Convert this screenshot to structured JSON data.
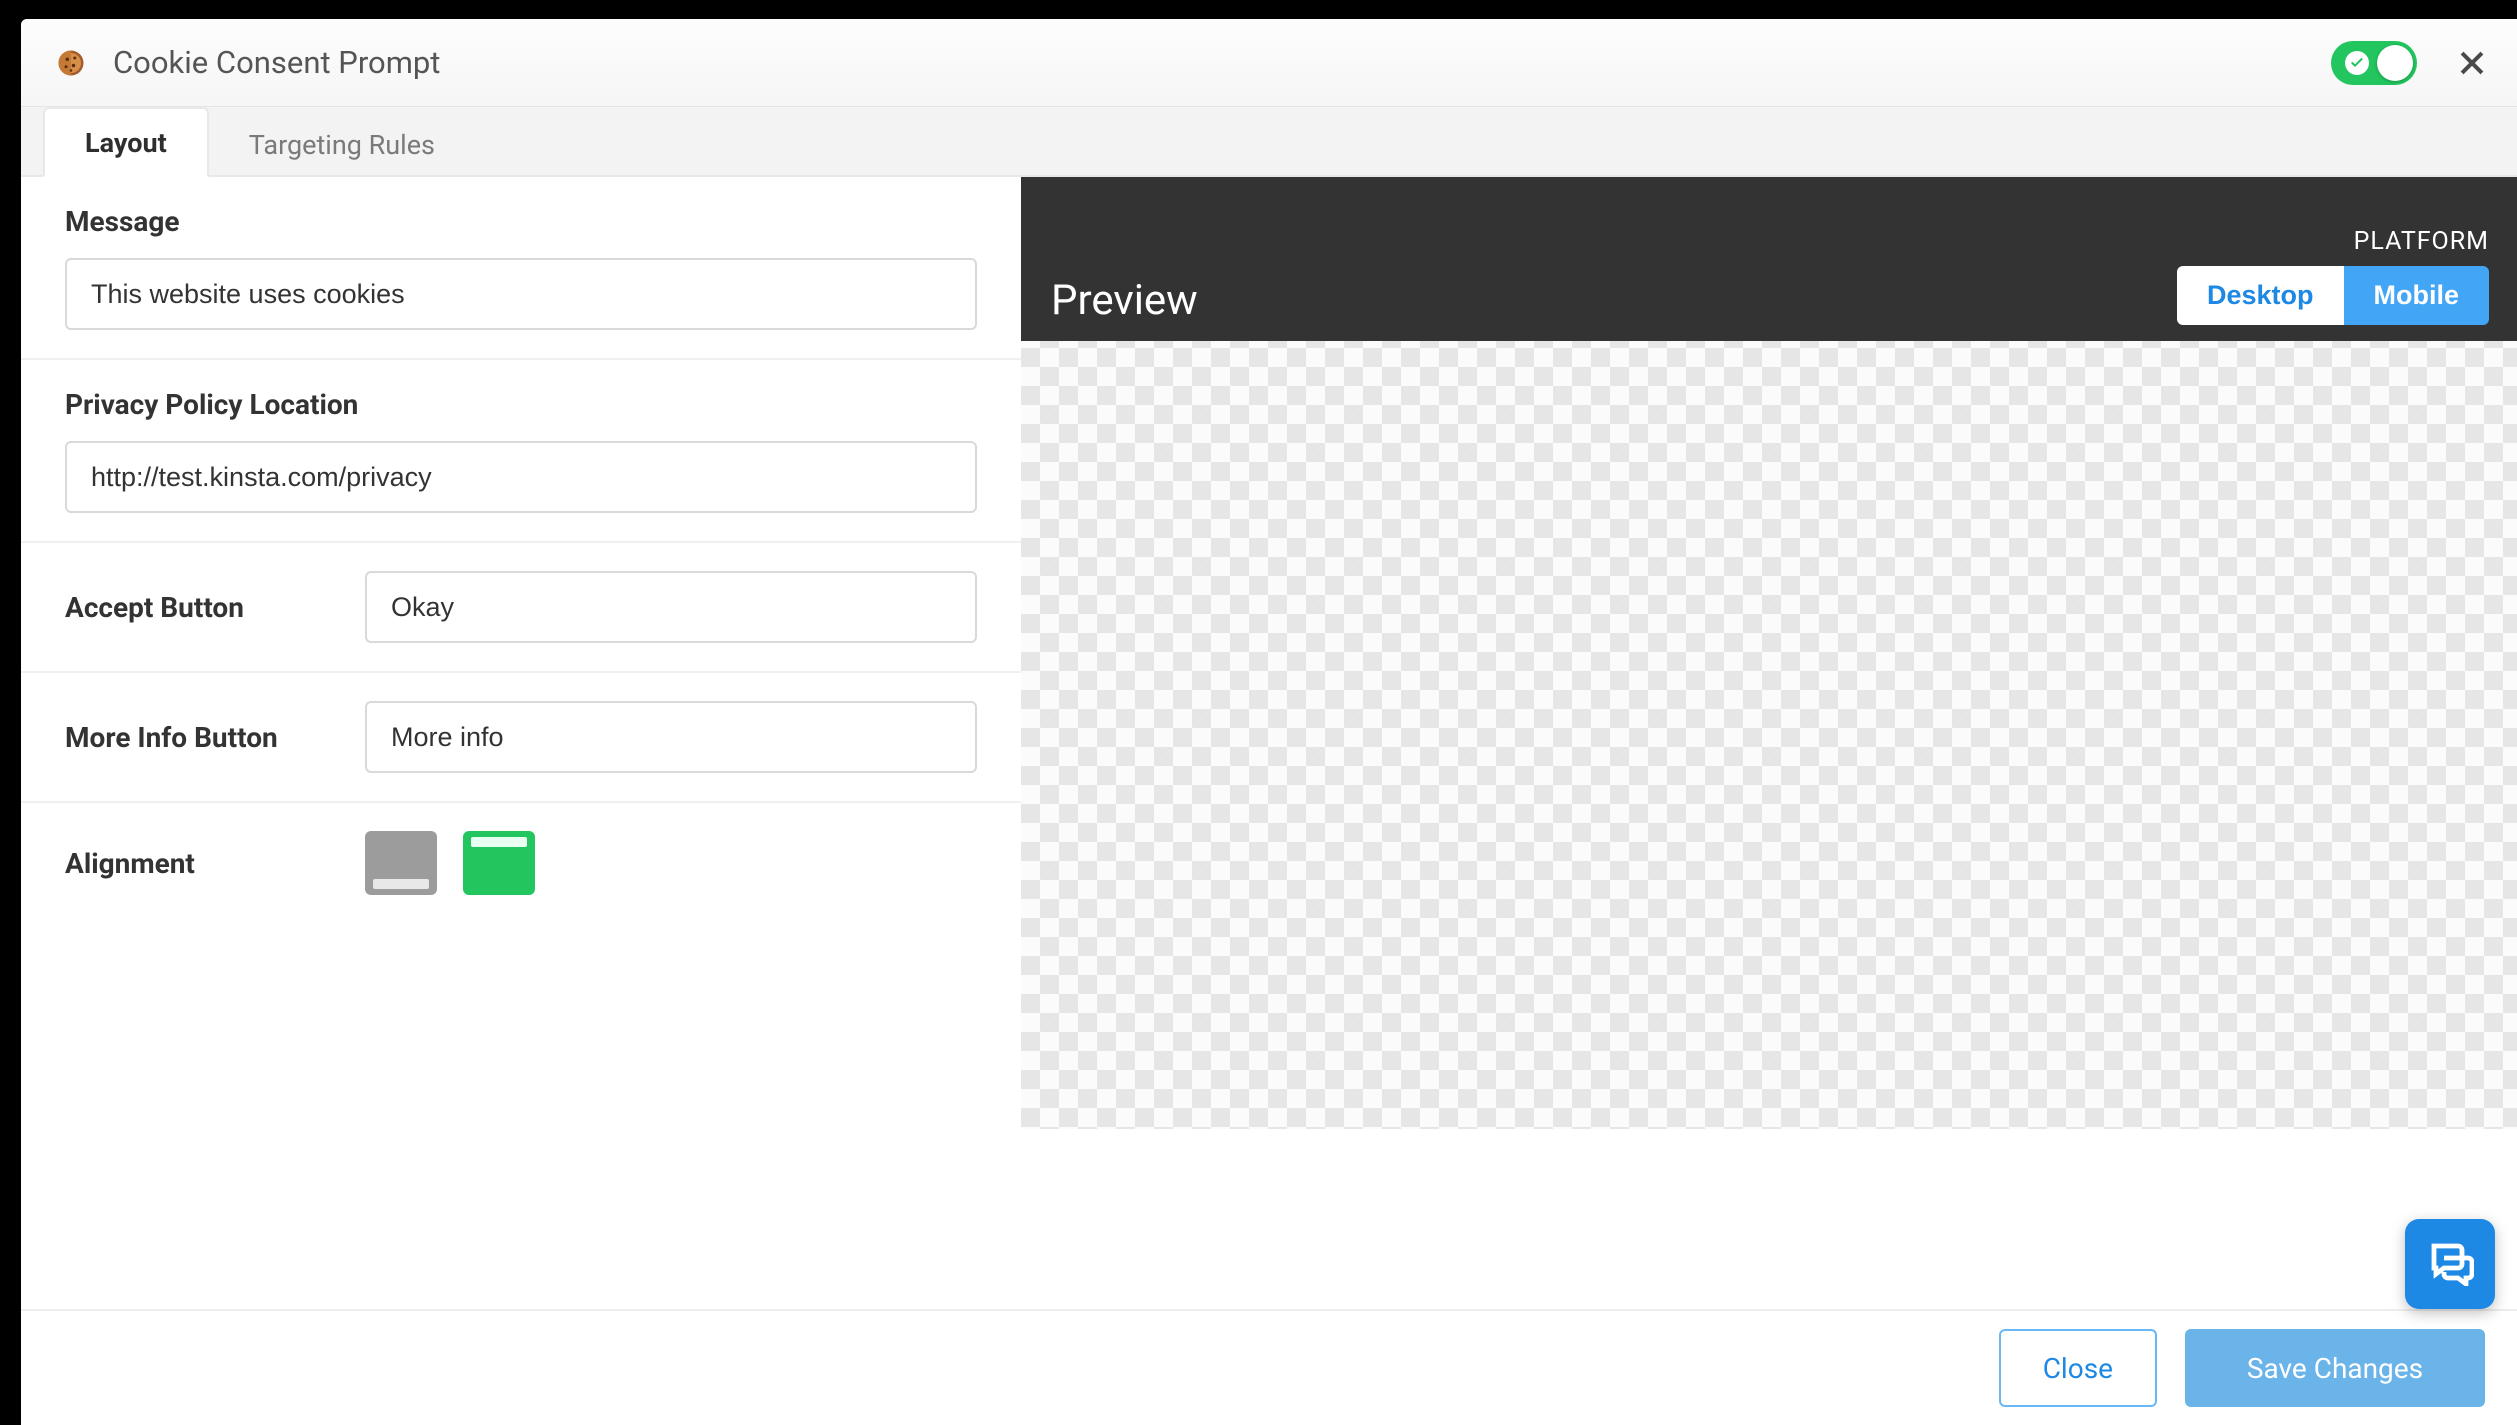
{
  "header": {
    "title": "Cookie Consent Prompt",
    "enabled": true
  },
  "tabs": {
    "layout": "Layout",
    "targeting": "Targeting Rules",
    "active": "layout"
  },
  "form": {
    "message_label": "Message",
    "message_value": "This website uses cookies",
    "privacy_label": "Privacy Policy Location",
    "privacy_value": "http://test.kinsta.com/privacy",
    "accept_label": "Accept Button",
    "accept_value": "Okay",
    "more_label": "More Info Button",
    "more_value": "More info",
    "alignment_label": "Alignment",
    "alignment_value": "top"
  },
  "preview": {
    "title": "Preview",
    "platform_label": "PLATFORM",
    "desktop": "Desktop",
    "mobile": "Mobile",
    "active": "mobile"
  },
  "footer": {
    "close": "Close",
    "save": "Save Changes"
  }
}
